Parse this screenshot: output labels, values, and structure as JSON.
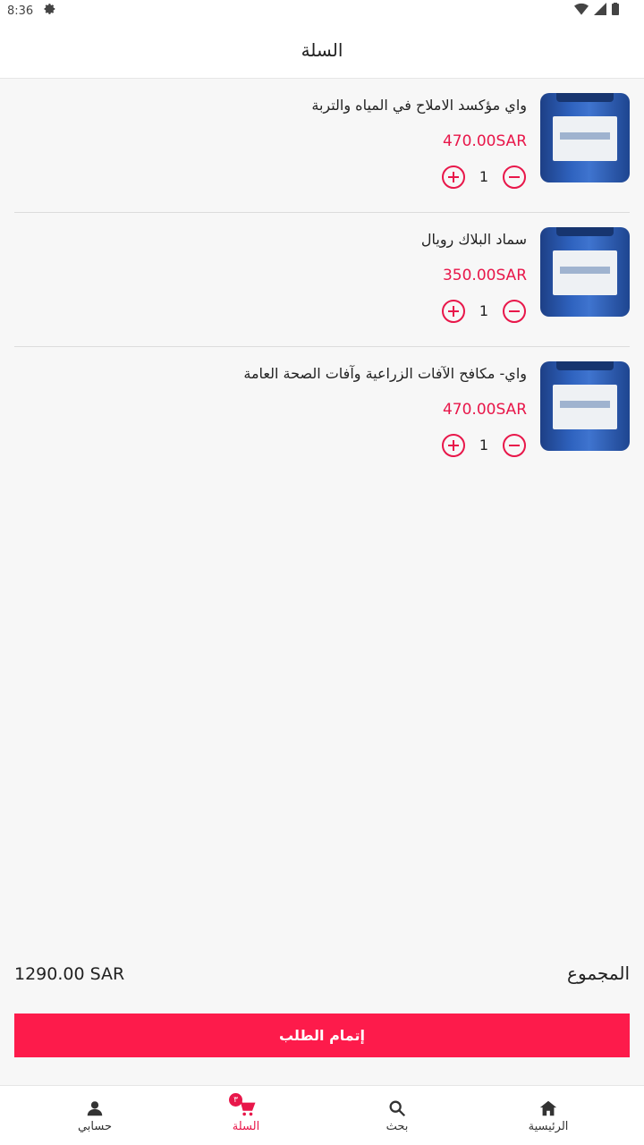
{
  "status_bar": {
    "time": "8:36"
  },
  "app_bar": {
    "title": "السلة"
  },
  "cart_items": [
    {
      "name": "واي مؤكسد الاملاح في المياه والتربة",
      "price": "470.00SAR",
      "quantity": "1"
    },
    {
      "name": "سماد البلاك رويال",
      "price": "350.00SAR",
      "quantity": "1"
    },
    {
      "name": "واي- مكافح الآفات الزراعية وآفات الصحة العامة",
      "price": "470.00SAR",
      "quantity": "1"
    }
  ],
  "summary": {
    "total_label": "المجموع",
    "total_amount": "1290.00 SAR"
  },
  "checkout": {
    "label": "إتمام الطلب"
  },
  "bottom_nav": {
    "items": [
      {
        "label": "الرئيسية",
        "icon": "home-icon"
      },
      {
        "label": "بحث",
        "icon": "search-icon"
      },
      {
        "label": "السلة",
        "icon": "cart-icon",
        "badge": "٣",
        "active": true
      },
      {
        "label": "حسابي",
        "icon": "person-icon"
      }
    ]
  },
  "colors": {
    "accent": "#e8174a",
    "button": "#fd1b4b",
    "background": "#f7f7f7"
  }
}
